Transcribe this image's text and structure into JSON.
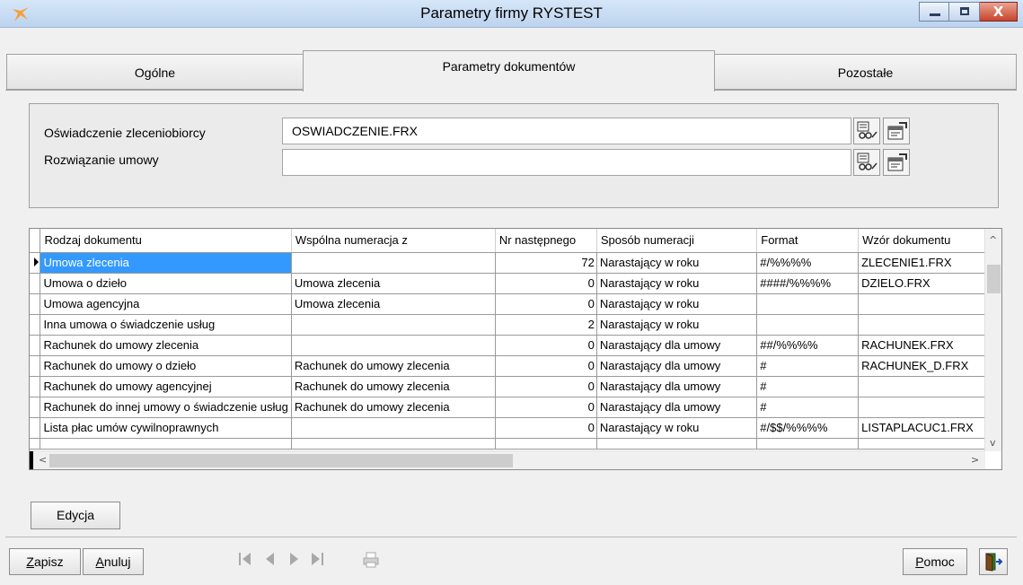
{
  "window": {
    "title": "Parametry firmy RYSTEST",
    "min_icon": "minimize-icon",
    "max_icon": "maximize-icon",
    "close_icon": "close-icon",
    "close_glyph": "X"
  },
  "tabs": [
    {
      "label": "Ogólne",
      "active": false
    },
    {
      "label": "Parametry dokumentów",
      "active": true
    },
    {
      "label": "Pozostałe",
      "active": false
    }
  ],
  "fields": {
    "oswiadczenie_label": "Oświadczenie zleceniobiorcy",
    "oswiadczenie_value": "OSWIADCZENIE.FRX",
    "rozwiazanie_label": "Rozwiązanie umowy",
    "rozwiazanie_value": ""
  },
  "grid": {
    "headers": [
      "Rodzaj dokumentu",
      "Wspólna numeracja z",
      "Nr następnego",
      "Sposób numeracji",
      "Format",
      "Wzór dokumentu"
    ],
    "rows": [
      [
        "Umowa zlecenia",
        "",
        "72",
        "Narastający w roku",
        "#/%%%%",
        "ZLECENIE1.FRX"
      ],
      [
        "Umowa o dzieło",
        "Umowa zlecenia",
        "0",
        "Narastający w roku",
        "####/%%%%",
        "DZIELO.FRX"
      ],
      [
        "Umowa agencyjna",
        "Umowa zlecenia",
        "0",
        "Narastający w roku",
        "",
        ""
      ],
      [
        "Inna umowa o świadczenie usług",
        "",
        "2",
        "Narastający w roku",
        "",
        ""
      ],
      [
        "Rachunek do umowy zlecenia",
        "",
        "0",
        "Narastający dla umowy",
        "##/%%%%",
        "RACHUNEK.FRX"
      ],
      [
        "Rachunek do umowy o dzieło",
        "Rachunek do umowy zlecenia",
        "0",
        "Narastający dla umowy",
        "#",
        "RACHUNEK_D.FRX"
      ],
      [
        "Rachunek do umowy agencyjnej",
        "Rachunek do umowy zlecenia",
        "0",
        "Narastający dla umowy",
        "#",
        ""
      ],
      [
        "Rachunek do innej umowy o świadczenie usług",
        "Rachunek do umowy zlecenia",
        "0",
        "Narastający dla umowy",
        "#",
        ""
      ],
      [
        "Lista płac umów cywilnoprawnych",
        "",
        "0",
        "Narastający w roku",
        "#/$$/%%%%",
        "LISTAPLACUC1.FRX"
      ]
    ],
    "scroll_up": "^",
    "scroll_down": "v",
    "scroll_left": "<",
    "scroll_right": ">"
  },
  "buttons": {
    "edycja": "Edycja",
    "zapisz_first": "Z",
    "zapisz_rest": "apisz",
    "anuluj_first": "A",
    "anuluj_rest": "nuluj",
    "pomoc_first": "P",
    "pomoc_rest": "omoc"
  },
  "icons": {
    "app": "app-logo-icon",
    "browse": "browse-report-icon",
    "properties": "properties-icon",
    "nav_first": "first-record-icon",
    "nav_prev": "previous-record-icon",
    "nav_next": "next-record-icon",
    "nav_last": "last-record-icon",
    "print": "print-icon",
    "exit": "exit-door-icon"
  }
}
